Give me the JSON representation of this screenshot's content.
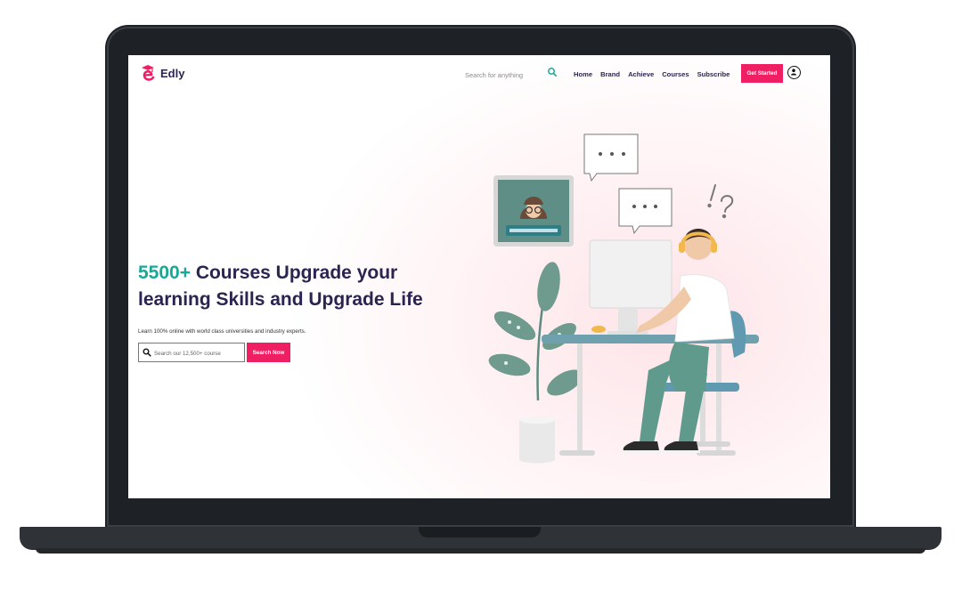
{
  "brand": {
    "name": "Edly",
    "color": "#f01f63",
    "accent": "#19a896",
    "ink": "#2b2350"
  },
  "nav": {
    "search_placeholder": "Search for anything",
    "search_icon": "search-icon",
    "menu": [
      {
        "label": "Home"
      },
      {
        "label": "Brand"
      },
      {
        "label": "Achieve"
      },
      {
        "label": "Courses"
      },
      {
        "label": "Subscribe"
      }
    ],
    "cta_label": "Get Started",
    "user_icon": "user-icon"
  },
  "hero": {
    "title_accent": "5500+",
    "title_rest": " Courses Upgrade your learning Skills and Upgrade Life",
    "subtitle": "Learn 100% online with world class universities and industry experts.",
    "search_placeholder": "Search our 12,500+ course",
    "search_button": "Search Now"
  }
}
